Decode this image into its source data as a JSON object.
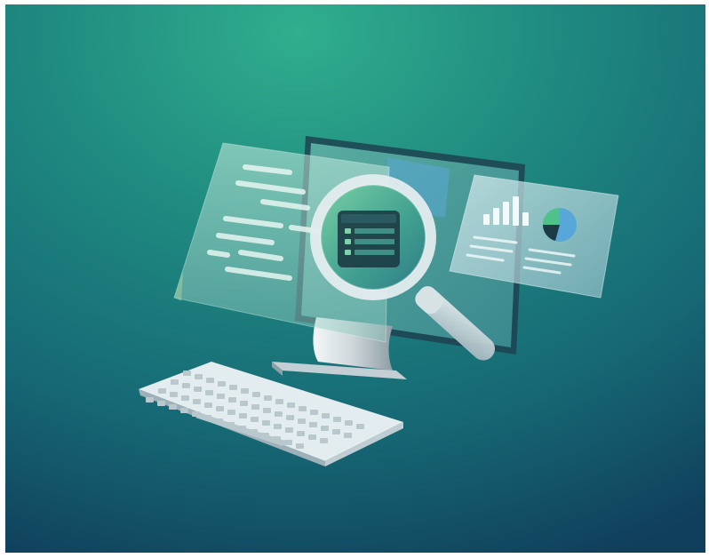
{
  "scene": {
    "subject": "illustration",
    "background_colors": [
      "#2fa88c",
      "#1d7f7c",
      "#135e72",
      "#0f3c5a"
    ],
    "screen_glass_color": "#9fd4c3",
    "accent_green": "#4fc28c",
    "accent_blue": "#57a7d8",
    "dark_icon_color": "#1c3b44",
    "keyboard_color": "#d8e3e6",
    "stand_color": "#d9e0e3"
  },
  "icons": [
    "monitor-icon",
    "magnifying-glass-icon",
    "table-list-icon",
    "bar-chart-icon",
    "pie-chart-icon",
    "keyboard-icon"
  ],
  "chart_panel": {
    "bar_levels": [
      0.35,
      0.55,
      0.75,
      0.95,
      0.45
    ],
    "pie_slices": [
      0.55,
      0.25,
      0.2
    ]
  }
}
